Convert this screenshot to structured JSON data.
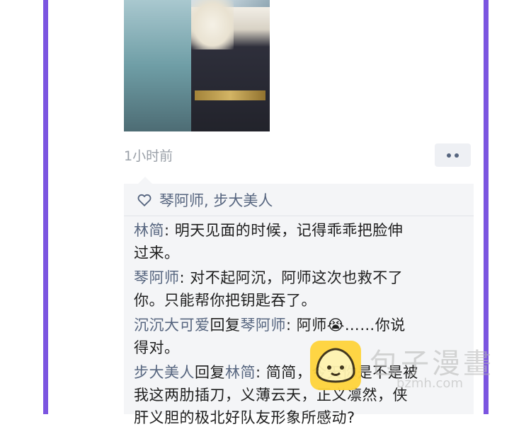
{
  "post": {
    "time": "1小时前"
  },
  "likes": {
    "names": "琴阿师, 步大美人"
  },
  "comments": [
    {
      "author": "林简",
      "reply_word": "",
      "reply_to": "",
      "text_line1": ": 明天见面的时候，记得乖乖把脸伸",
      "text_line2": "过来。"
    },
    {
      "author": "琴阿师",
      "reply_word": "",
      "reply_to": "",
      "text_line1": ": 对不起阿沉，阿师这次也救不了",
      "text_line2": "你。只能帮你把钥匙吞了。"
    },
    {
      "author": "沉沉大可爱",
      "reply_word": "回复",
      "reply_to": "琴阿师",
      "text_line1": ": 阿师😭……你说",
      "text_line2": "得对。"
    },
    {
      "author": "步大美人",
      "reply_word": "回复",
      "reply_to": "林简",
      "text_line1": ": 简简，今天你是不是被",
      "text_line2": "我这两肋插刀，义薄云天，正义凛然，侠",
      "text_line3": "肝义胆的极北好队友形象所感动?"
    }
  ],
  "watermark": {
    "text": "包子漫畫",
    "sub": "bzmh.com"
  },
  "colors": {
    "frame": "#7b55e0",
    "name": "#56657f",
    "comment_bg": "#f4f5f7"
  }
}
